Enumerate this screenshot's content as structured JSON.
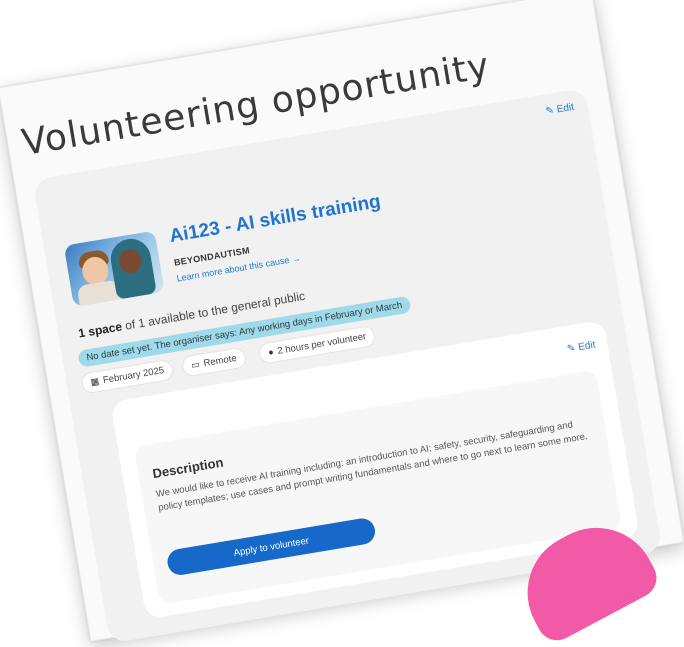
{
  "page_title": "Volunteering opportunity",
  "edit_label": "Edit",
  "opportunity": {
    "title": "Ai123 - AI skills training",
    "organisation": "BEYONDAUTISM",
    "learn_more": "Learn more about this cause →"
  },
  "spaces": {
    "bold": "1 space",
    "rest": " of 1 available to the general public"
  },
  "date_notice": "No date set yet. The organiser says: Any working days in February or March",
  "chips": {
    "date": "February 2025",
    "location": "Remote",
    "hours": "2 hours per volunteer"
  },
  "description": {
    "heading": "Description",
    "text": "We would like to receive AI training including: an introduction to AI; safety, security, safeguarding and policy templates; use cases and prompt writing fundamentals and where to go next to learn some more."
  },
  "apply_label": "Apply to volunteer",
  "colors": {
    "accent": "#1a76d2",
    "banner": "#9fd9ea",
    "button": "#1769c9",
    "decor_pink": "#f25aa8"
  },
  "icons": {
    "edit": "pencil-icon",
    "date": "calendar-icon",
    "location": "laptop-icon",
    "hours": "clock-icon"
  }
}
